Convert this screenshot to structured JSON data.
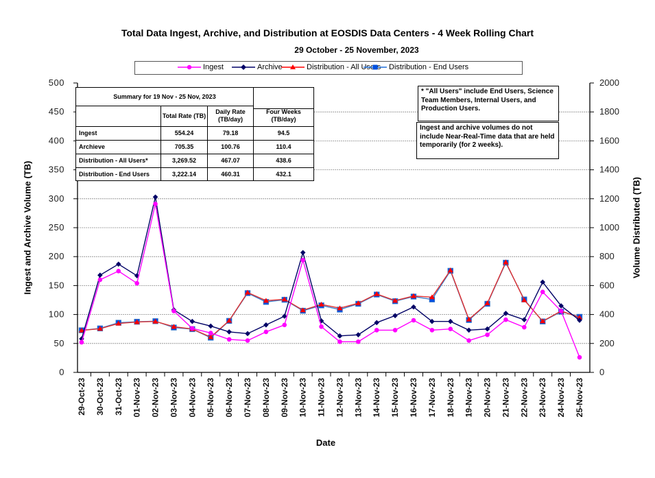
{
  "chart_data": {
    "type": "line",
    "title": "Total Data Ingest, Archive, and  Distribution at EOSDIS Data Centers - 4 Week Rolling Chart",
    "subtitle": "29 October  - 25 November, 2023",
    "xlabel": "Date",
    "ylabel_left": "Ingest and Archive Volume (TB)",
    "ylabel_right": "Volume Distributed (TB)",
    "ylim_left": [
      0,
      500
    ],
    "ylim_right": [
      0,
      2000
    ],
    "yticks_left": [
      "0",
      "50",
      "100",
      "150",
      "200",
      "250",
      "300",
      "350",
      "400",
      "450",
      "500"
    ],
    "yticks_right": [
      "0",
      "200",
      "400",
      "600",
      "800",
      "1000",
      "1200",
      "1400",
      "1600",
      "1800",
      "2000"
    ],
    "grid": true,
    "legend_placement": "top",
    "categories": [
      "29-Oct-23",
      "30-Oct-23",
      "31-Oct-23",
      "01-Nov-23",
      "02-Nov-23",
      "03-Nov-23",
      "04-Nov-23",
      "05-Nov-23",
      "06-Nov-23",
      "07-Nov-23",
      "08-Nov-23",
      "09-Nov-23",
      "10-Nov-23",
      "11-Nov-23",
      "12-Nov-23",
      "13-Nov-23",
      "14-Nov-23",
      "15-Nov-23",
      "16-Nov-23",
      "17-Nov-23",
      "18-Nov-23",
      "19-Nov-23",
      "20-Nov-23",
      "21-Nov-23",
      "22-Nov-23",
      "23-Nov-23",
      "24-Nov-23",
      "25-Nov-23"
    ],
    "series": [
      {
        "name": "Ingest",
        "axis": "left",
        "color": "#ff00ff",
        "marker": "circle",
        "values": [
          52,
          160,
          175,
          154,
          291,
          106,
          76,
          68,
          57,
          55,
          70,
          82,
          194,
          79,
          53,
          53,
          73,
          73,
          90,
          73,
          75,
          55,
          65,
          91,
          78,
          139,
          106,
          26
        ]
      },
      {
        "name": "Archive",
        "axis": "left",
        "color": "#000066",
        "marker": "diamond",
        "values": [
          58,
          168,
          187,
          167,
          303,
          108,
          88,
          80,
          70,
          67,
          82,
          97,
          207,
          89,
          63,
          65,
          86,
          98,
          113,
          88,
          88,
          73,
          75,
          102,
          91,
          156,
          115,
          90
        ]
      },
      {
        "name": "Distribution - All Users",
        "axis": "right",
        "color": "#ff0000",
        "marker": "triangle",
        "values": [
          290,
          302,
          338,
          348,
          352,
          316,
          300,
          244,
          358,
          552,
          496,
          505,
          430,
          470,
          444,
          478,
          542,
          496,
          528,
          520,
          706,
          366,
          478,
          762,
          500,
          354,
          424,
          380
        ]
      },
      {
        "name": "Distribution - End Users",
        "axis": "right",
        "color": "#0050e0",
        "marker": "square",
        "values": [
          291,
          304,
          343,
          350,
          354,
          310,
          299,
          240,
          356,
          548,
          487,
          502,
          426,
          463,
          434,
          474,
          538,
          492,
          524,
          504,
          702,
          362,
          474,
          758,
          504,
          352,
          420,
          384
        ]
      }
    ]
  },
  "legend": {
    "items": [
      {
        "label": "Ingest",
        "color": "#ff00ff"
      },
      {
        "label": "Archive",
        "color": "#000066"
      },
      {
        "label": "Distribution - All Users",
        "color": "#ff0000"
      },
      {
        "label": "Distribution - End Users",
        "color": "#1e6fd9"
      }
    ]
  },
  "summary": {
    "title": "Summary for  19 Nov  - 25 Nov, 2023",
    "headers": [
      "Total Rate (TB)",
      "Daily Rate (TB/day)",
      "Four Weeks (TB/day)"
    ],
    "rows": [
      {
        "label": "Ingest",
        "total": "554.24",
        "daily": "79.18",
        "four_weeks": "94.5"
      },
      {
        "label": "Archieve",
        "total": "705.35",
        "daily": "100.76",
        "four_weeks": "110.4"
      },
      {
        "label": "Distribution - All Users*",
        "total": "3,269.52",
        "daily": "467.07",
        "four_weeks": "438.6"
      },
      {
        "label": "Distribution - End Users",
        "total": "3,222.14",
        "daily": "460.31",
        "four_weeks": "432.1"
      }
    ]
  },
  "notes": {
    "all_users": "* \"All Users\" include End Users, Science Team Members,  Internal Users, and Production Users.",
    "nrt": "Ingest and archive volumes do not include Near-Real-Time data that are held temporarily (for 2 weeks)."
  }
}
